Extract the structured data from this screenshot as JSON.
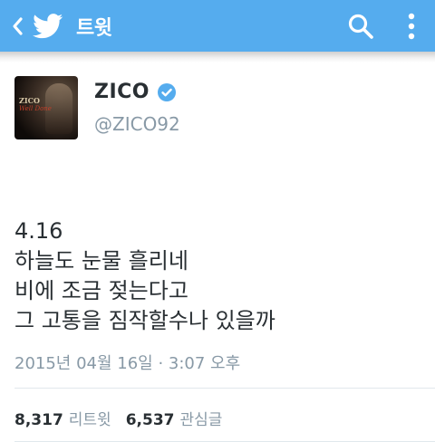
{
  "header": {
    "title": "트윗",
    "back_icon": "chevron-left-icon",
    "logo_icon": "twitter-bird-icon",
    "search_icon": "search-icon",
    "more_icon": "vertical-dots-icon",
    "color": "#55acee"
  },
  "tweet": {
    "author": {
      "name": "ZICO",
      "handle": "@ZICO92",
      "verified": true,
      "avatar_text": {
        "title": "ZICO",
        "subtitle": "Well Done"
      }
    },
    "text_lines": [
      "4.16",
      "하늘도 눈물 흘리네",
      "비에 조금 젖는다고",
      "그 고통을 짐작할수나 있을까"
    ],
    "timestamp": "2015년 04월 16일 · 3:07 오후",
    "stats": {
      "retweets_count": "8,317",
      "retweets_label": "리트윗",
      "favorites_count": "6,537",
      "favorites_label": "관심글"
    }
  }
}
